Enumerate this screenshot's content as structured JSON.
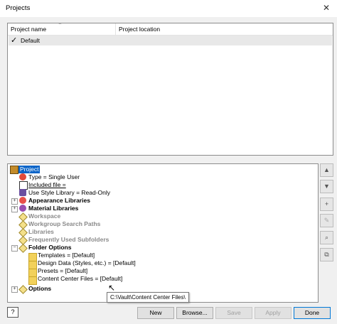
{
  "window": {
    "title": "Projects",
    "close_glyph": "✕"
  },
  "project_list": {
    "columns": [
      "Project name",
      "Project location"
    ],
    "rows": [
      {
        "name": "Default",
        "active_mark": "✓",
        "location": ""
      }
    ]
  },
  "tree": {
    "root": "Project",
    "items": [
      {
        "label": "Type = Single User"
      },
      {
        "label": "Included file ="
      },
      {
        "label": "Use Style Library = Read-Only"
      },
      {
        "label": "Appearance Libraries"
      },
      {
        "label": "Material Libraries"
      },
      {
        "label": "Workspace"
      },
      {
        "label": "Workgroup Search Paths"
      },
      {
        "label": "Libraries"
      },
      {
        "label": "Frequently Used Subfolders"
      },
      {
        "label": "Folder Options"
      },
      {
        "label": "Templates = [Default]"
      },
      {
        "label": "Design Data (Styles, etc.) = [Default]"
      },
      {
        "label": "Presets = [Default]"
      },
      {
        "label": "Content Center Files = [Default]"
      },
      {
        "label": "Options"
      }
    ],
    "tooltip": "C:\\Vault\\Content Center Files\\"
  },
  "side_buttons": {
    "up": "▲",
    "down": "▼",
    "add": "+",
    "edit": "✎",
    "find": "⌕",
    "copy": "⧉"
  },
  "buttons": {
    "help": "?",
    "new": "New",
    "browse": "Browse...",
    "save": "Save",
    "apply": "Apply",
    "done": "Done"
  }
}
